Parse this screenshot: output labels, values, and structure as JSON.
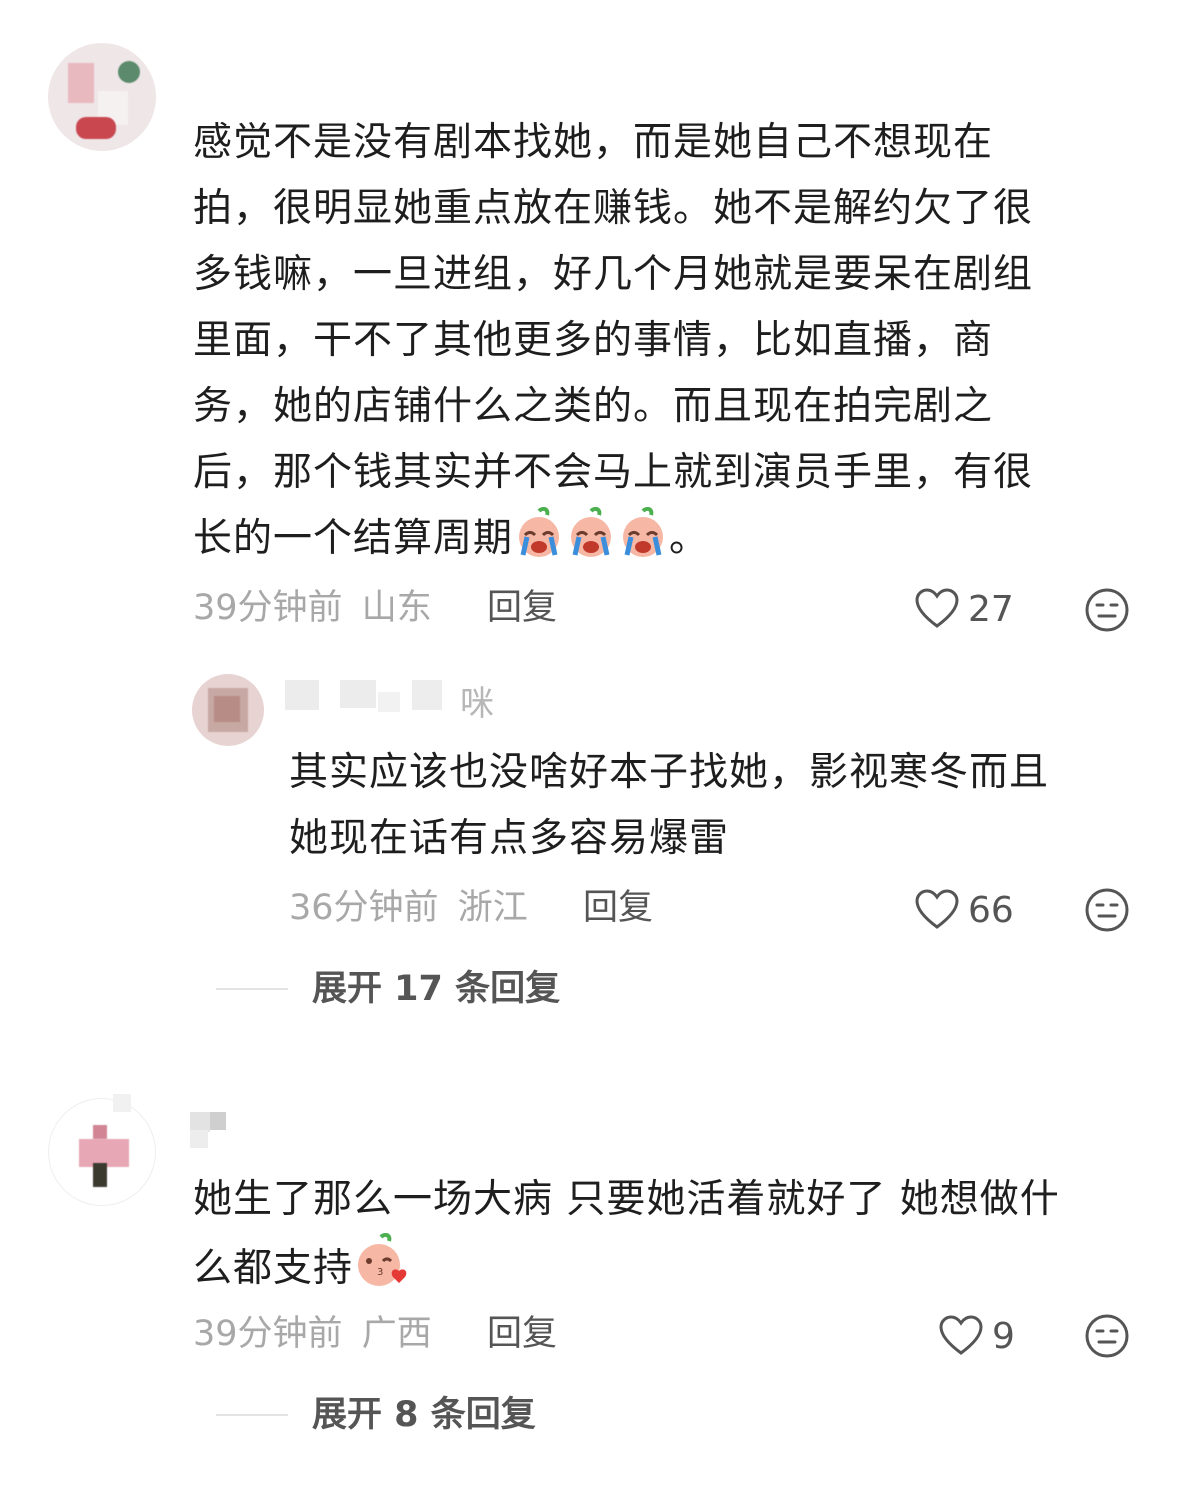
{
  "comments": [
    {
      "content_lines": [
        "感觉不是没有剧本找她，而是她自己不想现在",
        "拍，很明显她重点放在赚钱。她不是解约欠了很",
        "多钱嘛，一旦进组，好几个月她就是要呆在剧组",
        "里面，干不了其他更多的事情，比如直播，商",
        "务，她的店铺什么之类的。而且现在拍完剧之",
        "后，那个钱其实并不会马上就到演员手里，有很",
        "长的一个结算周期"
      ],
      "content_tail": "。",
      "emoji_icon": "crying-face-emoji",
      "time": "39分钟前",
      "location": "山东",
      "reply_label": "回复",
      "likes": "27",
      "reply": {
        "username_visible": "咪",
        "content_lines": [
          "其实应该也没啥好本子找她，影视寒冬而且",
          "她现在话有点多容易爆雷"
        ],
        "time": "36分钟前",
        "location": "浙江",
        "reply_label": "回复",
        "likes": "66"
      },
      "expand_label": "展开 17 条回复"
    },
    {
      "content_lines": [
        "她生了那么一场大病 只要她活着就好了 她想做什",
        "么都支持"
      ],
      "emoji_icon": "kissing-face-emoji",
      "time": "39分钟前",
      "location": "广西",
      "reply_label": "回复",
      "likes": "9",
      "expand_label": "展开 8 条回复"
    }
  ]
}
